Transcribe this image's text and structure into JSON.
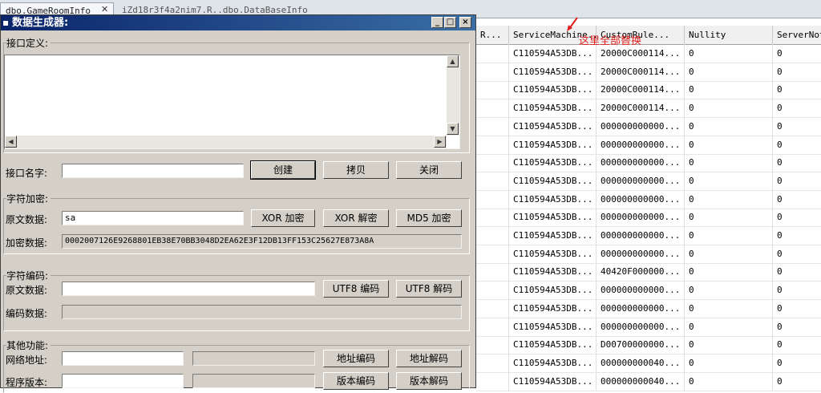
{
  "background_app": {
    "tabs": [
      {
        "label": "dbo.GameRoomInfo"
      },
      {
        "label": "iZd18r3f4a2nim7.R..dbo.DataBaseInfo"
      }
    ],
    "grid": {
      "headers": [
        "R...",
        "ServiceMachine...",
        "CustomRule...",
        "Nullity",
        "ServerNote"
      ],
      "rows": [
        [
          "",
          "C110594A53DB...",
          "20000C000114...",
          "0",
          "0"
        ],
        [
          "",
          "C110594A53DB...",
          "20000C000114...",
          "0",
          "0"
        ],
        [
          "",
          "C110594A53DB...",
          "20000C000114...",
          "0",
          "0"
        ],
        [
          "",
          "C110594A53DB...",
          "20000C000114...",
          "0",
          "0"
        ],
        [
          "",
          "C110594A53DB...",
          "000000000000...",
          "0",
          "0"
        ],
        [
          "",
          "C110594A53DB...",
          "000000000000...",
          "0",
          "0"
        ],
        [
          "",
          "C110594A53DB...",
          "000000000000...",
          "0",
          "0"
        ],
        [
          "",
          "C110594A53DB...",
          "000000000000...",
          "0",
          "0"
        ],
        [
          "",
          "C110594A53DB...",
          "000000000000...",
          "0",
          "0"
        ],
        [
          "",
          "C110594A53DB...",
          "000000000000...",
          "0",
          "0"
        ],
        [
          "",
          "C110594A53DB...",
          "000000000000...",
          "0",
          "0"
        ],
        [
          "",
          "C110594A53DB...",
          "000000000000...",
          "0",
          "0"
        ],
        [
          "",
          "C110594A53DB...",
          "40420F000000...",
          "0",
          "0"
        ],
        [
          "",
          "C110594A53DB...",
          "000000000000...",
          "0",
          "0"
        ],
        [
          "",
          "C110594A53DB...",
          "000000000000...",
          "0",
          "0"
        ],
        [
          "",
          "C110594A53DB...",
          "000000000000...",
          "0",
          "0"
        ],
        [
          "",
          "C110594A53DB...",
          "D00700000000...",
          "0",
          "0"
        ],
        [
          "",
          "C110594A53DB...",
          "000000000040...",
          "0",
          "0"
        ],
        [
          "",
          "C110594A53DB...",
          "000000000040...",
          "0",
          "0"
        ]
      ]
    },
    "annotation": {
      "text": "这里全部替换",
      "color": "#e02020"
    }
  },
  "dialog": {
    "title": "数据生成器:",
    "title_icon": "app-icon",
    "controls": {
      "minimize": "_",
      "maximize": "□",
      "close": "×"
    },
    "interface_def": {
      "label": "接口定义:",
      "content": ""
    },
    "interface_name": {
      "label": "接口名字:",
      "value": "",
      "create_label": "创建",
      "copy_label": "拷贝",
      "close_label": "关闭"
    },
    "char_encrypt": {
      "label": "字符加密:",
      "source_label": "原文数据:",
      "source_value": "sa",
      "xor_encrypt_label": "XOR 加密",
      "xor_decrypt_label": "XOR 解密",
      "md5_encrypt_label": "MD5 加密",
      "result_label": "加密数据:",
      "result_value": "0002007126E9268801EB38E70BB3048D2EA62E3F12DB13FF153C25627E873A8A"
    },
    "char_encode": {
      "label": "字符编码:",
      "source_label": "原文数据:",
      "source_value": "",
      "utf8_encode_label": "UTF8 编码",
      "utf8_decode_label": "UTF8 解码",
      "result_label": "编码数据:",
      "result_value": ""
    },
    "other": {
      "label": "其他功能:",
      "address_label": "网络地址:",
      "address_value": "",
      "address_result": "",
      "address_encode_label": "地址编码",
      "address_decode_label": "地址解码",
      "version_label": "程序版本:",
      "version_value": "",
      "version_result": "",
      "version_encode_label": "版本编码",
      "version_decode_label": "版本解码"
    }
  }
}
